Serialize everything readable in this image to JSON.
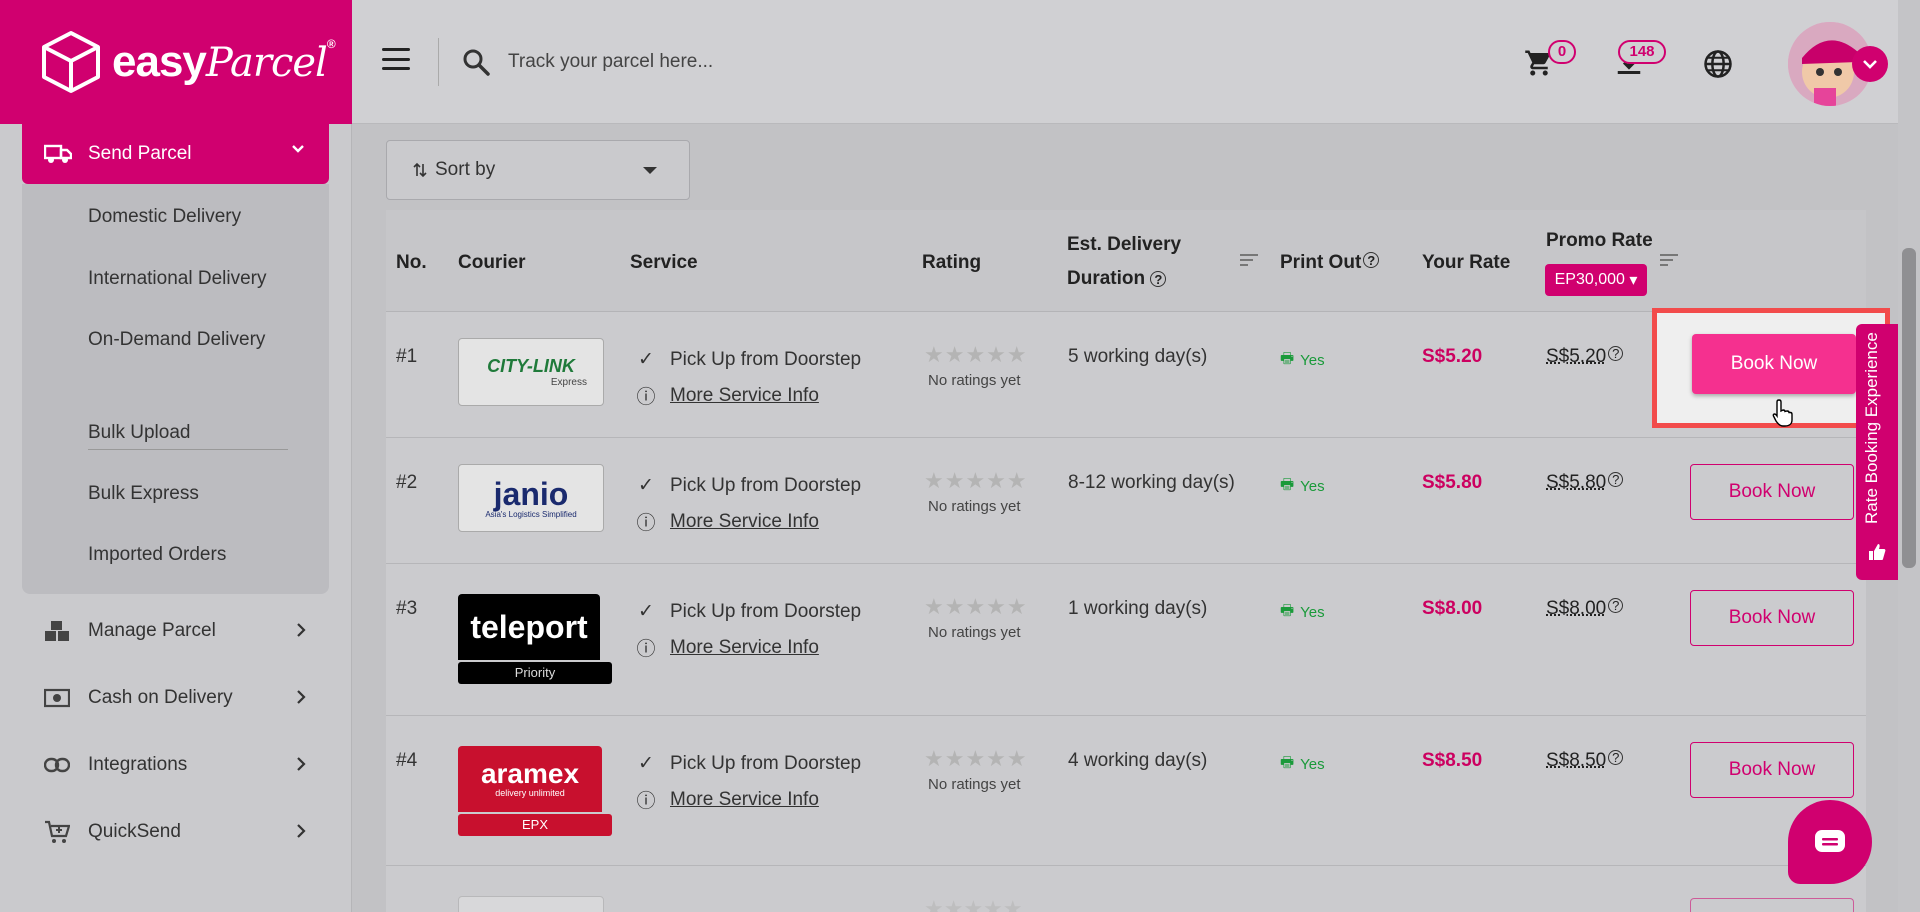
{
  "header": {
    "logo_text": "easy",
    "logo_script": "Parcel",
    "logo_reg": "®",
    "search_placeholder": "Track your parcel here...",
    "cart_count": "0",
    "notifications_count": "148"
  },
  "sidebar": {
    "send_parcel": "Send Parcel",
    "submenu": [
      "Domestic Delivery",
      "International Delivery",
      "On-Demand Delivery",
      "Bulk Upload",
      "Bulk Express",
      "Imported Orders"
    ],
    "nav": [
      "Manage Parcel",
      "Cash on Delivery",
      "Integrations",
      "QuickSend"
    ]
  },
  "sort": {
    "label": "Sort by"
  },
  "table": {
    "headers": {
      "no": "No.",
      "courier": "Courier",
      "service": "Service",
      "rating": "Rating",
      "duration_1": "Est. Delivery",
      "duration_2": "Duration",
      "print": "Print Out",
      "your_rate": "Your Rate",
      "promo_rate": "Promo Rate",
      "promo_code": "EP30,000"
    },
    "rows": [
      {
        "no": "#1",
        "courier": "CITY-LINK",
        "courier_sub": "Express",
        "service": "Pick Up from Doorstep",
        "more": "More Service Info",
        "rating": "No ratings yet",
        "duration": "5 working day(s)",
        "print": "Yes",
        "your_rate": "S$5.20",
        "promo_rate": "S$5.20",
        "book": "Book Now"
      },
      {
        "no": "#2",
        "courier": "janio",
        "courier_sub": "Asia's Logistics Simplified",
        "service": "Pick Up from Doorstep",
        "more": "More Service Info",
        "rating": "No ratings yet",
        "duration": "8-12 working day(s)",
        "print": "Yes",
        "your_rate": "S$5.80",
        "promo_rate": "S$5.80",
        "book": "Book Now"
      },
      {
        "no": "#3",
        "courier": "teleport",
        "courier_sub": "Priority",
        "service": "Pick Up from Doorstep",
        "more": "More Service Info",
        "rating": "No ratings yet",
        "duration": "1 working day(s)",
        "print": "Yes",
        "your_rate": "S$8.00",
        "promo_rate": "S$8.00",
        "book": "Book Now"
      },
      {
        "no": "#4",
        "courier": "aramex",
        "courier_sub": "delivery unlimited",
        "courier_tag": "EPX",
        "service": "Pick Up from Doorstep",
        "more": "More Service Info",
        "rating": "No ratings yet",
        "duration": "4 working day(s)",
        "print": "Yes",
        "your_rate": "S$8.50",
        "promo_rate": "S$8.50",
        "book": "Book Now"
      }
    ]
  },
  "rate_tab": {
    "label": "Rate Booking Experience"
  },
  "colors": {
    "brand": "#d0006f",
    "accent_button": "#f5308f",
    "print_yes": "#1a9a3a",
    "highlight": "#f24b4b"
  }
}
